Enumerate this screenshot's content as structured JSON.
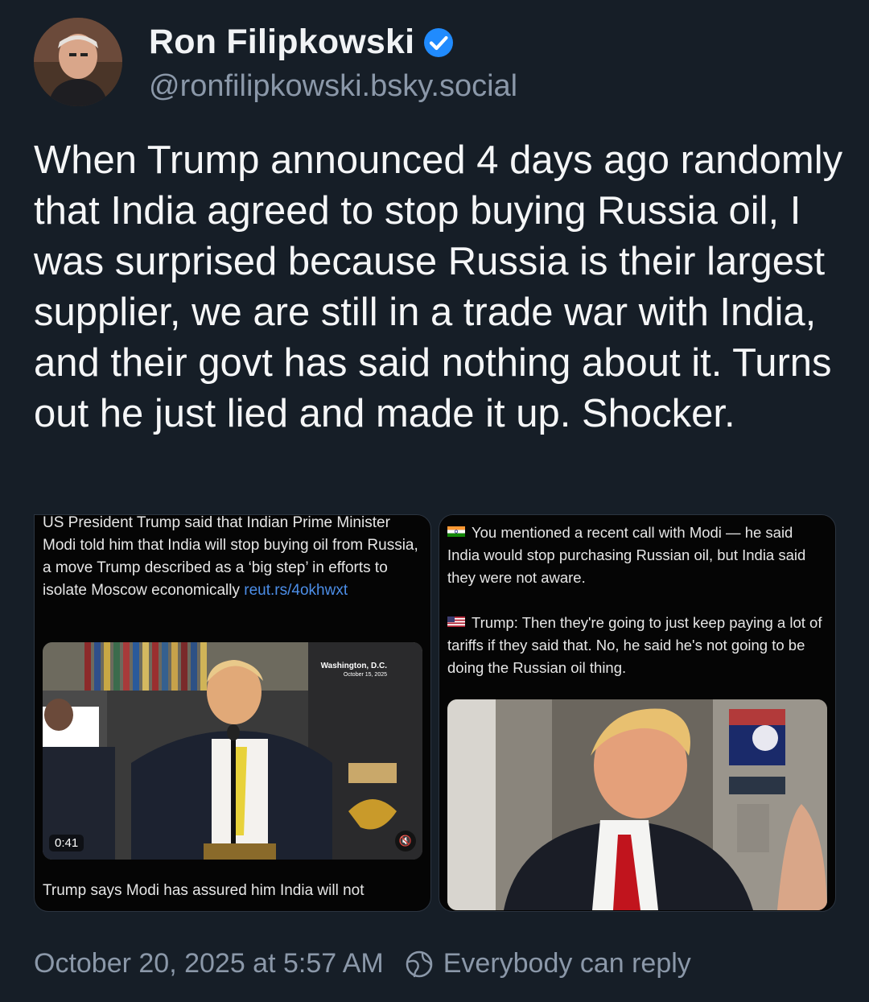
{
  "author": {
    "display_name": "Ron Filipkowski",
    "handle": "@ronfilipkowski.bsky.social",
    "verified": true,
    "avatar_icon": "avatar-photo"
  },
  "post": {
    "text": "When Trump announced 4 days ago randomly that India agreed to stop buying Russia oil, I was surprised because Russia is their largest supplier, we are still in a trade war with India, and their govt has said nothing about it. Turns out he just lied and made it up. Shocker."
  },
  "embeds": {
    "left": {
      "caption": "US President Trump said that Indian Prime Minister Modi told him that India will stop buying oil from Russia, a move Trump described as a ‘big step’ in efforts to isolate Moscow economically",
      "link": "reut.rs/4okhwxt",
      "video": {
        "dateline_city": "Washington, D.C.",
        "dateline_date": "October 15, 2025",
        "duration": "0:41",
        "mute_icon": "speaker-muted-icon"
      },
      "bottom_caption": "Trump says Modi has assured him India will not"
    },
    "right": {
      "q_text": "You mentioned a recent call with Modi — he said India would stop purchasing Russian oil, but India said they were not aware.",
      "q_flag": "india-flag-icon",
      "a_text": "Trump: Then they're going to just keep paying a lot of tariffs if they said that. No, he said he's not going to be doing the Russian oil thing.",
      "a_flag": "us-flag-icon"
    }
  },
  "footer": {
    "timestamp": "October 20, 2025 at 5:57 AM",
    "reply_setting": "Everybody can reply",
    "reply_icon": "reply-settings-icon"
  },
  "colors": {
    "background": "#161e27",
    "secondary_text": "#8b98a9",
    "verified_blue": "#208bfe",
    "link_blue": "#4c8ee8"
  }
}
